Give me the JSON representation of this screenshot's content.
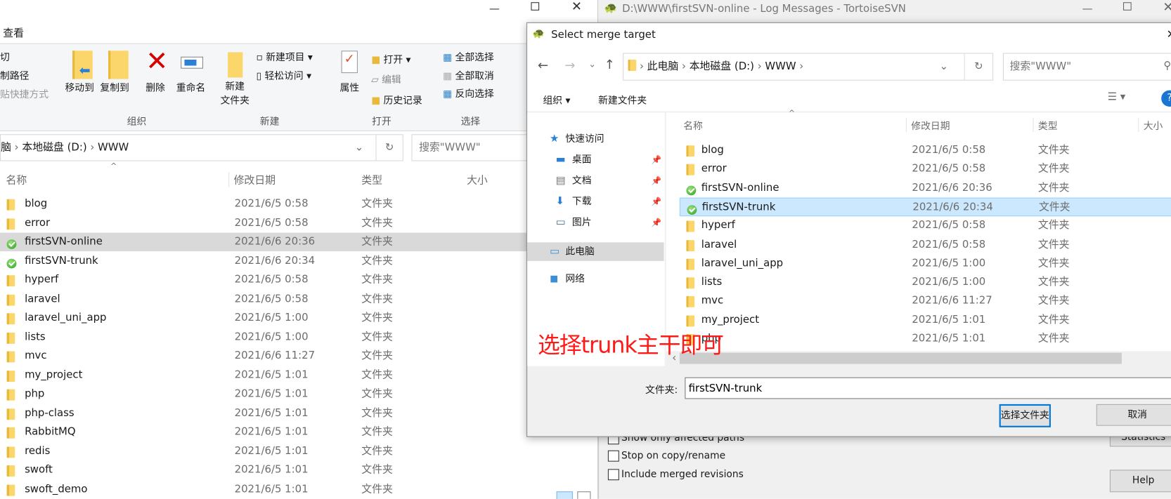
{
  "explorer": {
    "ribbon_tab": "查看",
    "clipboard": [
      "切",
      "制路径",
      "贴快捷方式"
    ],
    "organize": {
      "move": "移动到",
      "copy": "复制到",
      "delete": "删除",
      "rename": "重命名",
      "group": "组织"
    },
    "new": {
      "new_folder_1": "新建",
      "new_folder_2": "文件夹",
      "new_item": "新建项目",
      "easy_access": "轻松访问",
      "group": "新建"
    },
    "open": {
      "properties": "属性",
      "open": "打开",
      "edit": "编辑",
      "history": "历史记录",
      "group": "打开"
    },
    "select": {
      "all": "全部选择",
      "none": "全部取消",
      "invert": "反向选择",
      "group": "选择"
    },
    "breadcrumb": [
      "脑",
      "本地磁盘 (D:)",
      "WWW"
    ],
    "search_placeholder": "搜索\"WWW\"",
    "columns": [
      "名称",
      "修改日期",
      "类型",
      "大小"
    ],
    "files": [
      {
        "name": "blog",
        "date": "2021/6/5 0:58",
        "type": "文件夹",
        "svn": false
      },
      {
        "name": "error",
        "date": "2021/6/5 0:58",
        "type": "文件夹",
        "svn": false
      },
      {
        "name": "firstSVN-online",
        "date": "2021/6/6 20:36",
        "type": "文件夹",
        "svn": true
      },
      {
        "name": "firstSVN-trunk",
        "date": "2021/6/6 20:34",
        "type": "文件夹",
        "svn": true
      },
      {
        "name": "hyperf",
        "date": "2021/6/5 0:58",
        "type": "文件夹",
        "svn": false
      },
      {
        "name": "laravel",
        "date": "2021/6/5 0:58",
        "type": "文件夹",
        "svn": false
      },
      {
        "name": "laravel_uni_app",
        "date": "2021/6/5 1:00",
        "type": "文件夹",
        "svn": false
      },
      {
        "name": "lists",
        "date": "2021/6/5 1:00",
        "type": "文件夹",
        "svn": false
      },
      {
        "name": "mvc",
        "date": "2021/6/6 11:27",
        "type": "文件夹",
        "svn": false
      },
      {
        "name": "my_project",
        "date": "2021/6/5 1:01",
        "type": "文件夹",
        "svn": false
      },
      {
        "name": "php",
        "date": "2021/6/5 1:01",
        "type": "文件夹",
        "svn": false
      },
      {
        "name": "php-class",
        "date": "2021/6/5 1:01",
        "type": "文件夹",
        "svn": false
      },
      {
        "name": "RabbitMQ",
        "date": "2021/6/5 1:01",
        "type": "文件夹",
        "svn": false
      },
      {
        "name": "redis",
        "date": "2021/6/5 1:01",
        "type": "文件夹",
        "svn": false
      },
      {
        "name": "swoft",
        "date": "2021/6/5 1:01",
        "type": "文件夹",
        "svn": false
      },
      {
        "name": "swoft_demo",
        "date": "2021/6/5 1:01",
        "type": "文件夹",
        "svn": false
      }
    ]
  },
  "logwindow": {
    "title": "D:\\WWW\\firstSVN-online - Log Messages - TortoiseSVN",
    "checkboxes": [
      "Show only affected paths",
      "Stop on copy/rename",
      "Include merged revisions"
    ],
    "statistics": "Statistics",
    "help": "Help"
  },
  "dialog": {
    "title": "Select merge target",
    "breadcrumb": [
      "此电脑",
      "本地磁盘 (D:)",
      "WWW"
    ],
    "search_placeholder": "搜索\"WWW\"",
    "toolbar": {
      "organize": "组织 ▾",
      "new_folder": "新建文件夹"
    },
    "nav": [
      {
        "label": "快速访问",
        "icon": "star-icon"
      },
      {
        "label": "桌面",
        "icon": "desktop-icon",
        "pin": true
      },
      {
        "label": "文档",
        "icon": "document-icon",
        "pin": true
      },
      {
        "label": "下载",
        "icon": "download-icon",
        "pin": true
      },
      {
        "label": "图片",
        "icon": "picture-icon",
        "pin": true
      },
      {
        "label": "此电脑",
        "icon": "computer-icon"
      },
      {
        "label": "网络",
        "icon": "network-icon"
      }
    ],
    "columns": [
      "名称",
      "修改日期",
      "类型",
      "大小"
    ],
    "selected": "firstSVN-trunk",
    "folder_label": "文件夹:",
    "folder_value": "firstSVN-trunk",
    "ok": "选择文件夹",
    "cancel": "取消"
  },
  "annotation": "选择trunk主干即可",
  "colors": {
    "annotation": "#ff1a1a",
    "selection": "#cce8ff",
    "accent": "#0078d7"
  }
}
